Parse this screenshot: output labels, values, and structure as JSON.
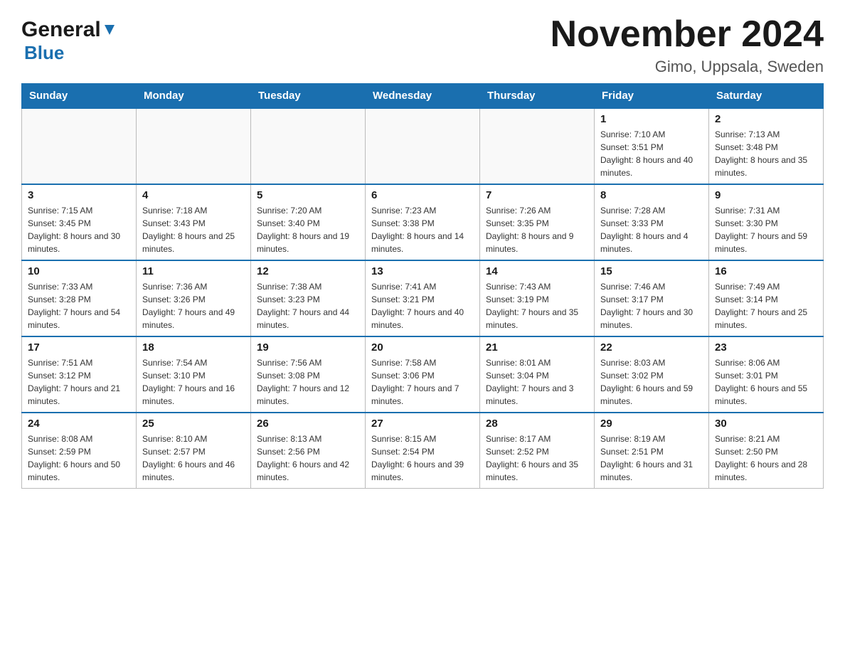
{
  "header": {
    "logo_general": "General",
    "logo_blue": "Blue",
    "title": "November 2024",
    "subtitle": "Gimo, Uppsala, Sweden"
  },
  "days_of_week": [
    "Sunday",
    "Monday",
    "Tuesday",
    "Wednesday",
    "Thursday",
    "Friday",
    "Saturday"
  ],
  "weeks": [
    [
      {
        "day": "",
        "info": ""
      },
      {
        "day": "",
        "info": ""
      },
      {
        "day": "",
        "info": ""
      },
      {
        "day": "",
        "info": ""
      },
      {
        "day": "",
        "info": ""
      },
      {
        "day": "1",
        "info": "Sunrise: 7:10 AM\nSunset: 3:51 PM\nDaylight: 8 hours and 40 minutes."
      },
      {
        "day": "2",
        "info": "Sunrise: 7:13 AM\nSunset: 3:48 PM\nDaylight: 8 hours and 35 minutes."
      }
    ],
    [
      {
        "day": "3",
        "info": "Sunrise: 7:15 AM\nSunset: 3:45 PM\nDaylight: 8 hours and 30 minutes."
      },
      {
        "day": "4",
        "info": "Sunrise: 7:18 AM\nSunset: 3:43 PM\nDaylight: 8 hours and 25 minutes."
      },
      {
        "day": "5",
        "info": "Sunrise: 7:20 AM\nSunset: 3:40 PM\nDaylight: 8 hours and 19 minutes."
      },
      {
        "day": "6",
        "info": "Sunrise: 7:23 AM\nSunset: 3:38 PM\nDaylight: 8 hours and 14 minutes."
      },
      {
        "day": "7",
        "info": "Sunrise: 7:26 AM\nSunset: 3:35 PM\nDaylight: 8 hours and 9 minutes."
      },
      {
        "day": "8",
        "info": "Sunrise: 7:28 AM\nSunset: 3:33 PM\nDaylight: 8 hours and 4 minutes."
      },
      {
        "day": "9",
        "info": "Sunrise: 7:31 AM\nSunset: 3:30 PM\nDaylight: 7 hours and 59 minutes."
      }
    ],
    [
      {
        "day": "10",
        "info": "Sunrise: 7:33 AM\nSunset: 3:28 PM\nDaylight: 7 hours and 54 minutes."
      },
      {
        "day": "11",
        "info": "Sunrise: 7:36 AM\nSunset: 3:26 PM\nDaylight: 7 hours and 49 minutes."
      },
      {
        "day": "12",
        "info": "Sunrise: 7:38 AM\nSunset: 3:23 PM\nDaylight: 7 hours and 44 minutes."
      },
      {
        "day": "13",
        "info": "Sunrise: 7:41 AM\nSunset: 3:21 PM\nDaylight: 7 hours and 40 minutes."
      },
      {
        "day": "14",
        "info": "Sunrise: 7:43 AM\nSunset: 3:19 PM\nDaylight: 7 hours and 35 minutes."
      },
      {
        "day": "15",
        "info": "Sunrise: 7:46 AM\nSunset: 3:17 PM\nDaylight: 7 hours and 30 minutes."
      },
      {
        "day": "16",
        "info": "Sunrise: 7:49 AM\nSunset: 3:14 PM\nDaylight: 7 hours and 25 minutes."
      }
    ],
    [
      {
        "day": "17",
        "info": "Sunrise: 7:51 AM\nSunset: 3:12 PM\nDaylight: 7 hours and 21 minutes."
      },
      {
        "day": "18",
        "info": "Sunrise: 7:54 AM\nSunset: 3:10 PM\nDaylight: 7 hours and 16 minutes."
      },
      {
        "day": "19",
        "info": "Sunrise: 7:56 AM\nSunset: 3:08 PM\nDaylight: 7 hours and 12 minutes."
      },
      {
        "day": "20",
        "info": "Sunrise: 7:58 AM\nSunset: 3:06 PM\nDaylight: 7 hours and 7 minutes."
      },
      {
        "day": "21",
        "info": "Sunrise: 8:01 AM\nSunset: 3:04 PM\nDaylight: 7 hours and 3 minutes."
      },
      {
        "day": "22",
        "info": "Sunrise: 8:03 AM\nSunset: 3:02 PM\nDaylight: 6 hours and 59 minutes."
      },
      {
        "day": "23",
        "info": "Sunrise: 8:06 AM\nSunset: 3:01 PM\nDaylight: 6 hours and 55 minutes."
      }
    ],
    [
      {
        "day": "24",
        "info": "Sunrise: 8:08 AM\nSunset: 2:59 PM\nDaylight: 6 hours and 50 minutes."
      },
      {
        "day": "25",
        "info": "Sunrise: 8:10 AM\nSunset: 2:57 PM\nDaylight: 6 hours and 46 minutes."
      },
      {
        "day": "26",
        "info": "Sunrise: 8:13 AM\nSunset: 2:56 PM\nDaylight: 6 hours and 42 minutes."
      },
      {
        "day": "27",
        "info": "Sunrise: 8:15 AM\nSunset: 2:54 PM\nDaylight: 6 hours and 39 minutes."
      },
      {
        "day": "28",
        "info": "Sunrise: 8:17 AM\nSunset: 2:52 PM\nDaylight: 6 hours and 35 minutes."
      },
      {
        "day": "29",
        "info": "Sunrise: 8:19 AM\nSunset: 2:51 PM\nDaylight: 6 hours and 31 minutes."
      },
      {
        "day": "30",
        "info": "Sunrise: 8:21 AM\nSunset: 2:50 PM\nDaylight: 6 hours and 28 minutes."
      }
    ]
  ]
}
